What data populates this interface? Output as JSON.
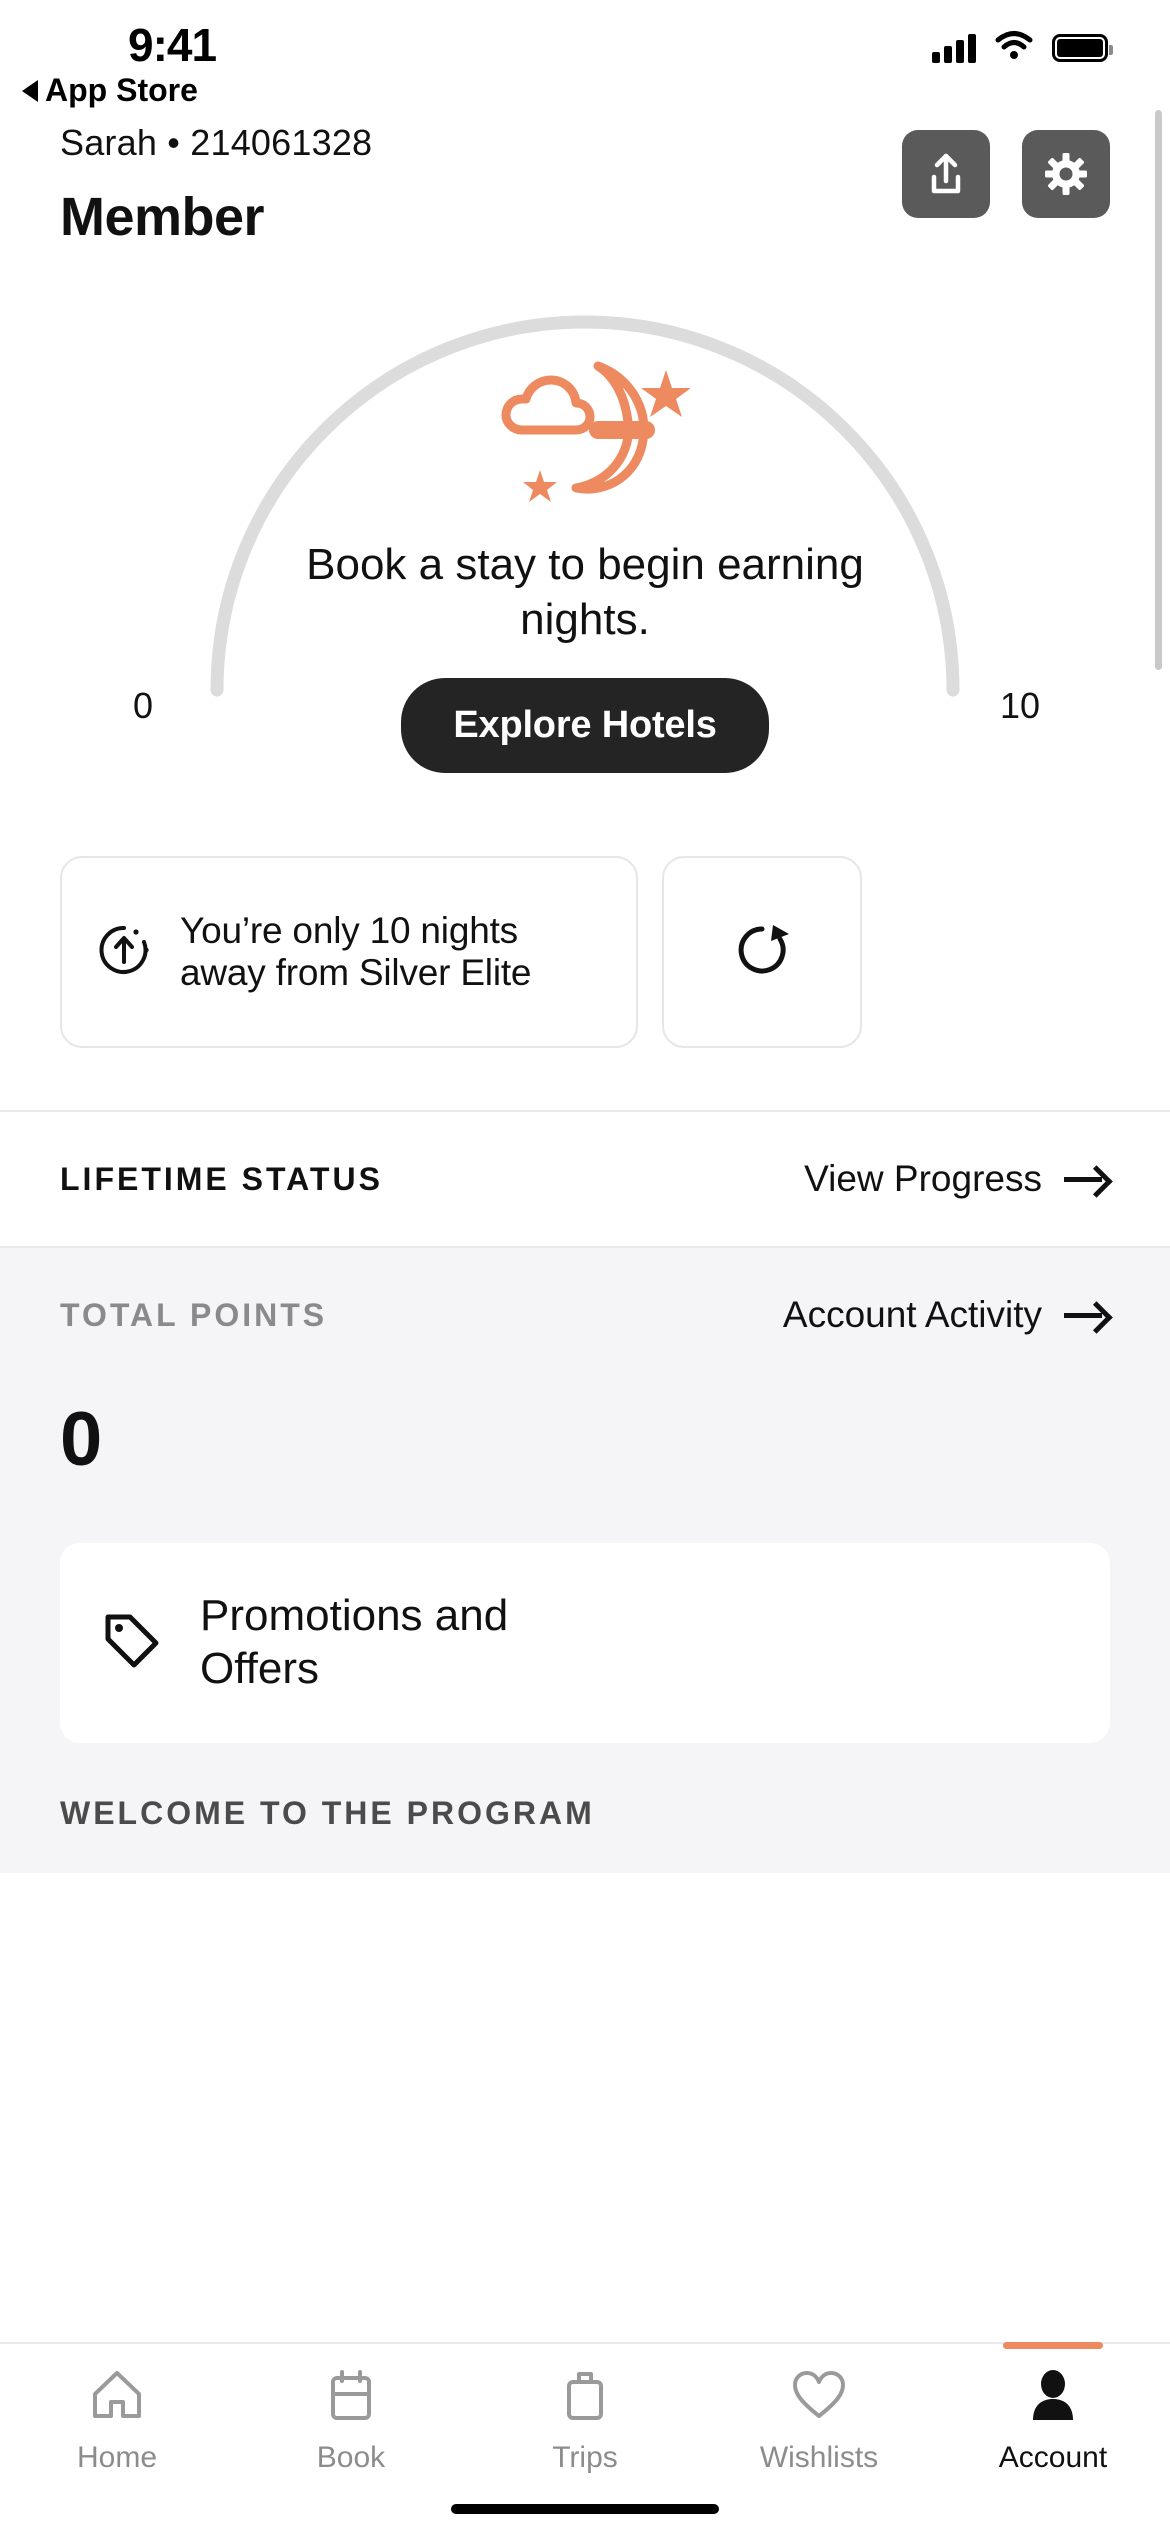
{
  "status_bar": {
    "time": "9:41",
    "back_label": "App Store",
    "icons": [
      "cellular-signal-icon",
      "wifi-icon",
      "battery-icon"
    ]
  },
  "header": {
    "member_name": "Sarah",
    "separator": "•",
    "member_number": "214061328",
    "meta_line": "Sarah • 214061328",
    "tier_title": "Member",
    "actions": [
      {
        "name": "share-button",
        "icon": "share-upload-icon"
      },
      {
        "name": "settings-button",
        "icon": "gear-icon"
      }
    ]
  },
  "gauge": {
    "min_label": "0",
    "max_label": "10",
    "illustration": "moon-cloud-stars-icon",
    "message": "Book a stay to begin earning nights.",
    "cta_label": "Explore Hotels",
    "track_color": "#dcdcdc",
    "accent_color": "#ee8a5f"
  },
  "progress_cards": [
    {
      "icon": "arrow-up-circle-icon",
      "text": "You’re only 10 nights away from Silver Elite"
    },
    {
      "icon": "refresh-circle-icon",
      "text": ""
    }
  ],
  "lifetime_status": {
    "label": "LIFETIME STATUS",
    "action_label": "View Progress",
    "action_icon": "arrow-right-icon"
  },
  "total_points": {
    "label": "TOTAL POINTS",
    "action_label": "Account Activity",
    "action_icon": "arrow-right-icon",
    "value": "0"
  },
  "promotions": {
    "icon": "price-tag-icon",
    "title": "Promotions and Offers"
  },
  "welcome": {
    "label": "WELCOME TO THE PROGRAM"
  },
  "tab_bar": {
    "items": [
      {
        "label": "Home",
        "icon": "home-icon",
        "active": false
      },
      {
        "label": "Book",
        "icon": "calendar-icon",
        "active": false
      },
      {
        "label": "Trips",
        "icon": "briefcase-icon",
        "active": false
      },
      {
        "label": "Wishlists",
        "icon": "heart-icon",
        "active": false
      },
      {
        "label": "Account",
        "icon": "person-icon",
        "active": true
      }
    ]
  }
}
